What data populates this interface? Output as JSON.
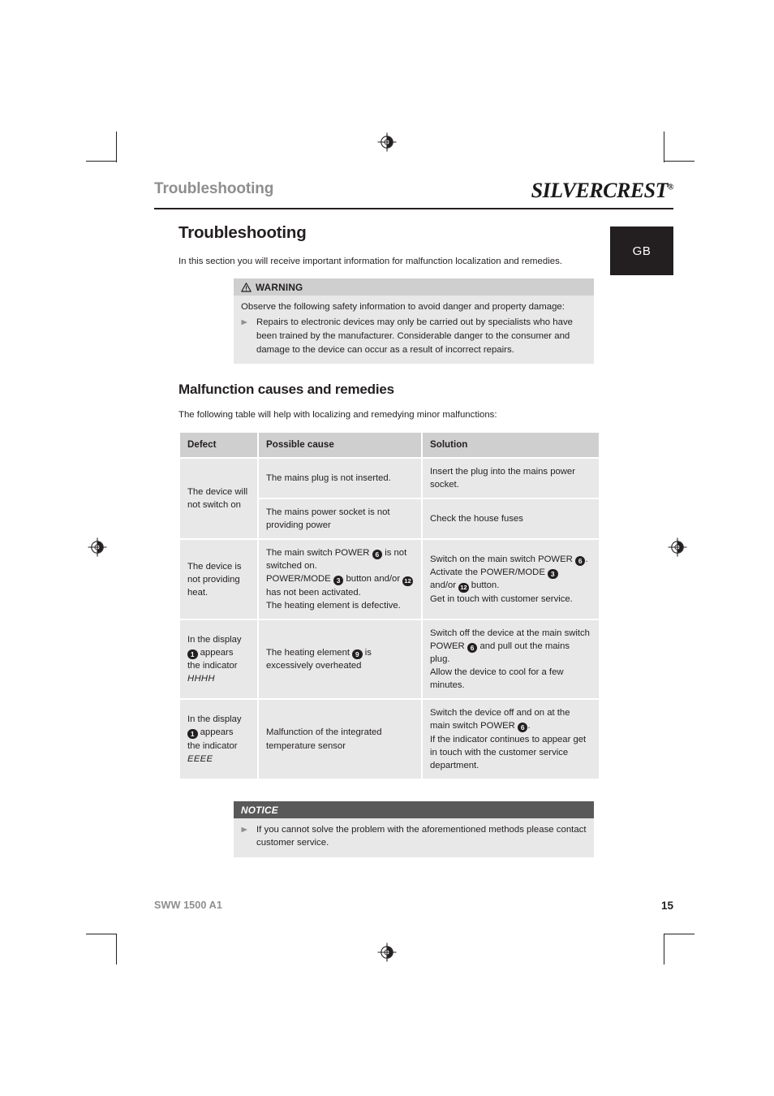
{
  "running_header": {
    "title": "Troubleshooting",
    "logo_silver": "SILVER",
    "logo_crest": "CREST",
    "logo_registered": "®"
  },
  "lang_badge": {
    "label": "GB"
  },
  "page": {
    "title": "Troubleshooting",
    "intro": "In this section you will receive important information for malfunction localization and remedies."
  },
  "warning_box": {
    "icon": "warning-triangle-icon",
    "heading": "WARNING",
    "intro": "Observe the following safety information to avoid danger and property damage:",
    "bullet_mark": "►",
    "bullet": "Repairs to electronic devices may only be carried out by specialists who have been trained by the manufacturer. Considerable danger to the consumer and damage to the device can occur as a result of incorrect repairs."
  },
  "section": {
    "title": "Malfunction causes and remedies",
    "intro": "The following table will help with localizing and remedying minor malfunctions:"
  },
  "table": {
    "headers": [
      "Defect",
      "Possible cause",
      "Solution"
    ],
    "rows": [
      {
        "defect": "The device will not switch on",
        "defect_rowspan": 2,
        "cause": "The mains plug is not inserted.",
        "solution": "Insert the plug into the mains power socket."
      },
      {
        "cause": "The mains power socket is not providing power",
        "solution": "Check the house fuses"
      },
      {
        "defect": "The device is not providing heat.",
        "defect_rowspan": 1,
        "cause_parts": [
          "The main switch POWER ",
          "6",
          " is not switched on.\nPOWER/MODE ",
          "3",
          " button and/or ",
          "12",
          " has not been activated.\nThe heating element is defective."
        ],
        "cause_plain": "The main switch POWER 6 is not switched on. POWER/MODE 3 button and/or 12 has not been activated. The heating element is defective.",
        "solution_plain": "Switch on the main switch POWER 6. Activate the POWER/MODE 3 and/or 12 button. Get in touch with customer service."
      },
      {
        "defect_plain": "In the display 1 appears the indicator HHHH",
        "defect_line1": "In the display",
        "defect_num": "1",
        "defect_line2": "appears",
        "defect_line3": "the indicator",
        "defect_code": "HHHH",
        "cause_plain": "The heating element 9 is excessively overheated",
        "solution_plain": "Switch off the device at the main switch POWER 6 and pull out the mains plug. Allow the device to cool for a few minutes."
      },
      {
        "defect_plain": "In the display 1 appears the indicator EEEE",
        "defect_line1": "In the display",
        "defect_num": "1",
        "defect_line2": "appears",
        "defect_line3": "the indicator",
        "defect_code": "EEEE",
        "cause_plain": "Malfunction of the integrated temperature sensor",
        "solution_plain": "Switch the device off and on at the main switch POWER 6. If the indicator continues to appear get in touch with the customer service department."
      }
    ]
  },
  "notice_box": {
    "heading": "NOTICE",
    "bullet_mark": "►",
    "bullet": "If you cannot solve the problem with the aforementioned methods please contact customer service."
  },
  "footer": {
    "model": "SWW 1500 A1",
    "page_number": "15"
  },
  "colors": {
    "text": "#231f20",
    "muted": "#8e8e8e",
    "table_header_bg": "#cfcfcf",
    "table_cell_bg": "#e8e8e8",
    "notice_bar_bg": "#595959",
    "badge_bg": "#231f20"
  }
}
